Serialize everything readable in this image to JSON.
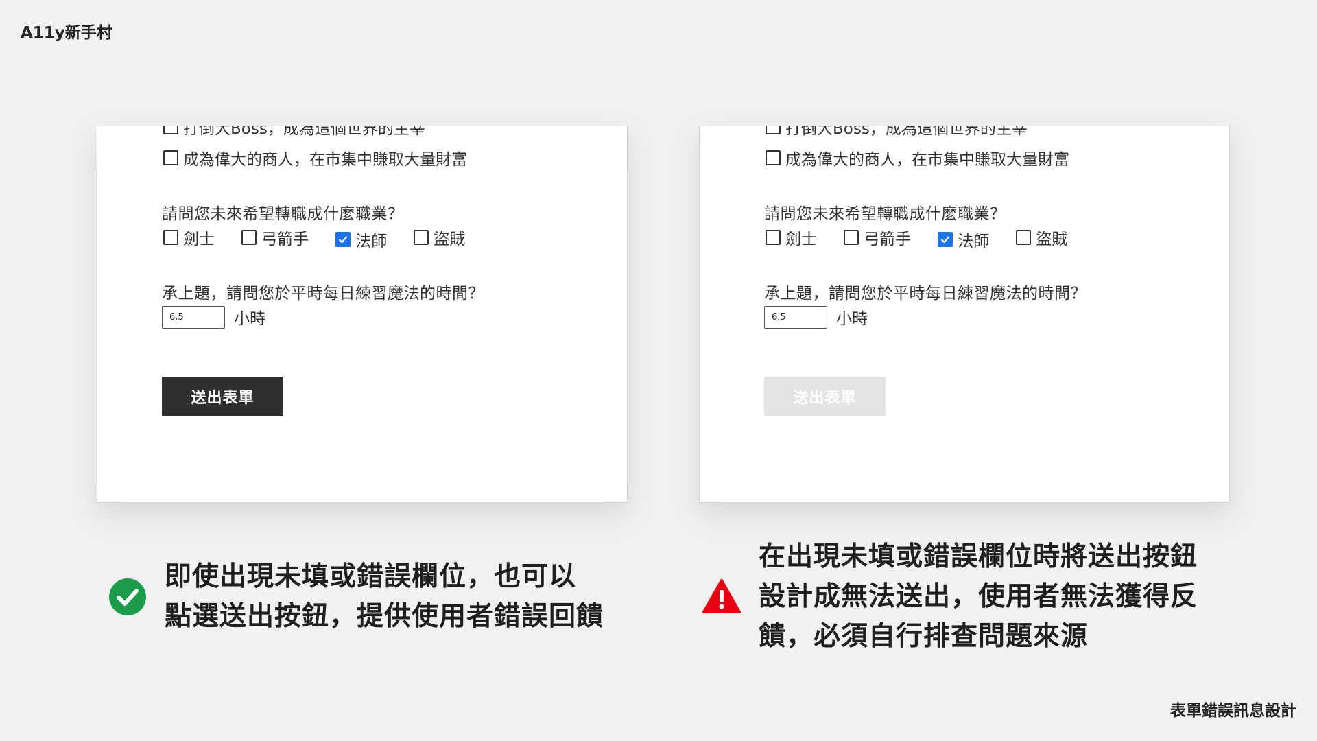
{
  "brand": "A11y新手村",
  "footer_title": "表單錯誤訊息設計",
  "form": {
    "clipped_option": "打倒大Boss，成為這個世界的主宰",
    "merchant_option": "成為偉大的商人，在市集中賺取大量財富",
    "question_job": "請問您未來希望轉職成什麼職業？",
    "job_options": [
      {
        "label": "劍士",
        "checked": false
      },
      {
        "label": "弓箭手",
        "checked": false
      },
      {
        "label": "法師",
        "checked": true
      },
      {
        "label": "盜賊",
        "checked": false
      }
    ],
    "question_hours": "承上題，請問您於平時每日練習魔法的時間？",
    "hours_value": "6.5",
    "hours_unit": "小時",
    "submit_label": "送出表單"
  },
  "captions": {
    "good": {
      "icon": "check-circle-icon",
      "color": "#1a9c4a",
      "line1": "即使出現未填或錯誤欄位，也可以",
      "line2": "點選送出按鈕，提供使用者錯誤回饋"
    },
    "bad": {
      "icon": "warning-triangle-icon",
      "color": "#e60012",
      "line1": "在出現未填或錯誤欄位時將送出按鈕",
      "line2": "設計成無法送出，使用者無法獲得反",
      "line3": "饋，必須自行排查問題來源"
    }
  },
  "colors": {
    "checkbox_checked": "#1a73e8",
    "button_enabled": "#2f2f2f",
    "button_disabled": "#e4e4e4"
  }
}
